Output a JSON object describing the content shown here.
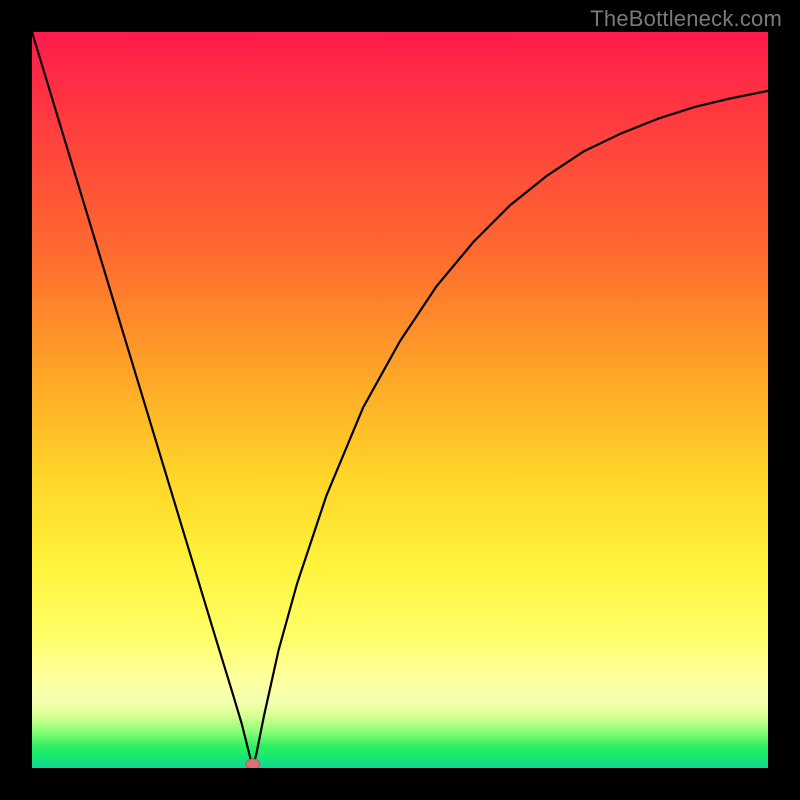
{
  "watermark": "TheBottleneck.com",
  "chart_data": {
    "type": "line",
    "title": "",
    "xlabel": "",
    "ylabel": "",
    "xlim": [
      0,
      1
    ],
    "ylim": [
      0,
      1
    ],
    "grid": false,
    "series": [
      {
        "name": "bottleneck-curve",
        "x": [
          0.0,
          0.05,
          0.1,
          0.15,
          0.2,
          0.25,
          0.27,
          0.285,
          0.295,
          0.3,
          0.305,
          0.315,
          0.335,
          0.36,
          0.4,
          0.45,
          0.5,
          0.55,
          0.6,
          0.65,
          0.7,
          0.75,
          0.8,
          0.85,
          0.9,
          0.95,
          1.0
        ],
        "y": [
          1.0,
          0.835,
          0.67,
          0.505,
          0.34,
          0.175,
          0.11,
          0.06,
          0.02,
          0.0,
          0.02,
          0.07,
          0.16,
          0.25,
          0.37,
          0.49,
          0.58,
          0.655,
          0.715,
          0.765,
          0.805,
          0.838,
          0.862,
          0.882,
          0.898,
          0.91,
          0.92
        ]
      }
    ],
    "min_marker": {
      "x": 0.3,
      "y": 0.0,
      "color": "#d87078"
    },
    "background_gradient": {
      "type": "vertical",
      "stops": [
        {
          "pos": 0.0,
          "color": "#ff1a4d"
        },
        {
          "pos": 0.3,
          "color": "#ff6a2f"
        },
        {
          "pos": 0.6,
          "color": "#ffd428"
        },
        {
          "pos": 0.82,
          "color": "#ffff66"
        },
        {
          "pos": 0.92,
          "color": "#d6ff90"
        },
        {
          "pos": 1.0,
          "color": "#10d890"
        }
      ]
    }
  }
}
